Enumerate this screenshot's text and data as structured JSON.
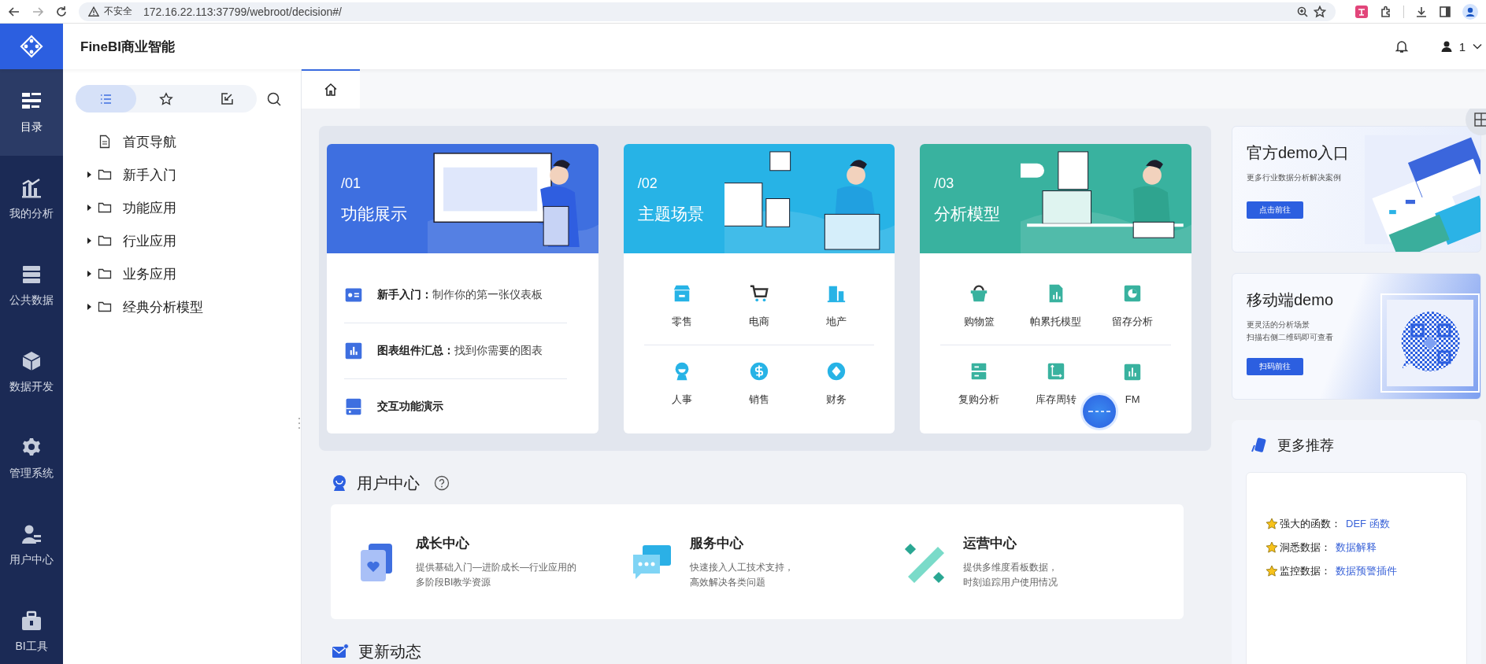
{
  "browser": {
    "security": "不安全",
    "url": "172.16.22.113:37799/webroot/decision#/"
  },
  "header": {
    "title": "FineBI商业智能",
    "user": "1"
  },
  "nav": [
    {
      "label": "目录",
      "selected": true
    },
    {
      "label": "我的分析",
      "selected": false
    },
    {
      "label": "公共数据",
      "selected": false
    },
    {
      "label": "数据开发",
      "selected": false
    },
    {
      "label": "管理系统",
      "selected": false
    },
    {
      "label": "用户中心",
      "selected": false
    },
    {
      "label": "BI工具",
      "selected": false
    }
  ],
  "tree": {
    "tabs": [
      {
        "kind": "list",
        "selected": true
      },
      {
        "kind": "star",
        "selected": false
      },
      {
        "kind": "import",
        "selected": false
      }
    ],
    "items": [
      {
        "kind": "file",
        "label": "首页导航"
      },
      {
        "kind": "folder",
        "label": "新手入门",
        "expanded": false
      },
      {
        "kind": "folder",
        "label": "功能应用",
        "expanded": false
      },
      {
        "kind": "folder",
        "label": "行业应用",
        "expanded": false
      },
      {
        "kind": "folder",
        "label": "业务应用",
        "expanded": false
      },
      {
        "kind": "folder",
        "label": "经典分析模型",
        "expanded": false
      }
    ]
  },
  "tabs": [
    {
      "kind": "home",
      "selected": true
    }
  ],
  "cards": [
    {
      "kind": "list",
      "number": "/01",
      "title": "功能展示",
      "color": "#3e6fe0",
      "items": [
        {
          "label": "**新手入门：**制作你的第一张仪表板"
        },
        {
          "label": "**图表组件汇总：**找到你需要的图表"
        },
        {
          "label": "**交互功能演示**"
        }
      ]
    },
    {
      "kind": "grid",
      "number": "/02",
      "title": "主题场景",
      "color": "#27b3e6",
      "items": [
        {
          "label": "零售"
        },
        {
          "label": "电商"
        },
        {
          "label": "地产"
        },
        {
          "label": "人事"
        },
        {
          "label": "销售"
        },
        {
          "label": "财务"
        }
      ]
    },
    {
      "kind": "grid",
      "number": "/03",
      "title": "分析模型",
      "color": "#39b29f",
      "items": [
        {
          "label": "购物篮"
        },
        {
          "label": "帕累托模型"
        },
        {
          "label": "留存分析"
        },
        {
          "label": "复购分析"
        },
        {
          "label": "库存周转"
        },
        {
          "label": "FM"
        }
      ]
    }
  ],
  "user_center": {
    "title": "用户中心",
    "items": [
      {
        "title": "成长中心",
        "desc": [
          "提供基础入门—进阶成长—行业应用的",
          "多阶段BI教学资源"
        ]
      },
      {
        "title": "服务中心",
        "desc": [
          "快速接入人工技术支持，",
          "高效解决各类问题"
        ]
      },
      {
        "title": "运营中心",
        "desc": [
          "提供多维度看板数据，",
          "时刻追踪用户使用情况"
        ]
      }
    ]
  },
  "updates": {
    "title": "更新动态"
  },
  "demos": [
    {
      "kind": "official",
      "title": "官方demo入口",
      "subtitle": [
        "更多行业数据分析解决案例"
      ],
      "button": "点击前往"
    },
    {
      "kind": "mobile",
      "title": "移动端demo",
      "subtitle": [
        "更灵活的分析场景",
        "扫描右侧二维码即可查看"
      ],
      "button": "扫码前往"
    }
  ],
  "more": {
    "title": "更多推荐",
    "items": [
      {
        "label": "强大的函数：",
        "link": "DEF 函数"
      },
      {
        "label": "洞悉数据：",
        "link": "数据解释"
      },
      {
        "label": "监控数据：",
        "link": "数据预警插件"
      }
    ]
  }
}
